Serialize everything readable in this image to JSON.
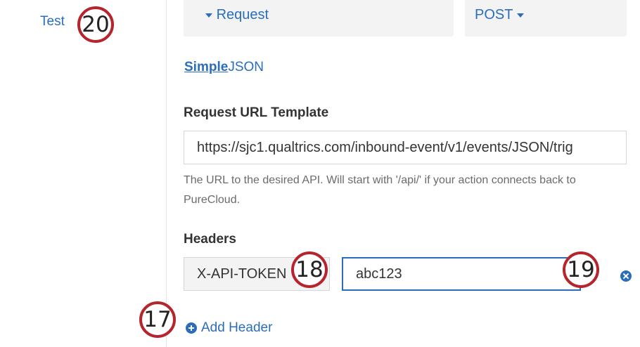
{
  "sidebar": {
    "test_link": "Test"
  },
  "request": {
    "section_label": "Request",
    "method": "POST"
  },
  "mode_toggle": {
    "active": "Simple",
    "other": "JSON"
  },
  "url_template": {
    "label": "Request URL Template",
    "value": "https://sjc1.qualtrics.com/inbound-event/v1/events/JSON/trig",
    "help": "The URL to the desired API. Will start with '/api/' if your action connects back to PureCloud."
  },
  "headers": {
    "label": "Headers",
    "rows": [
      {
        "key": "X-API-TOKEN",
        "value": "abc123"
      }
    ],
    "add_label": "Add Header"
  },
  "callouts": {
    "c17": "17",
    "c18": "18",
    "c19": "19",
    "c20": "20"
  },
  "colors": {
    "accent": "#2a6ebb",
    "callout_ring": "#b5252e",
    "panel_bg": "#f3f3f3"
  }
}
